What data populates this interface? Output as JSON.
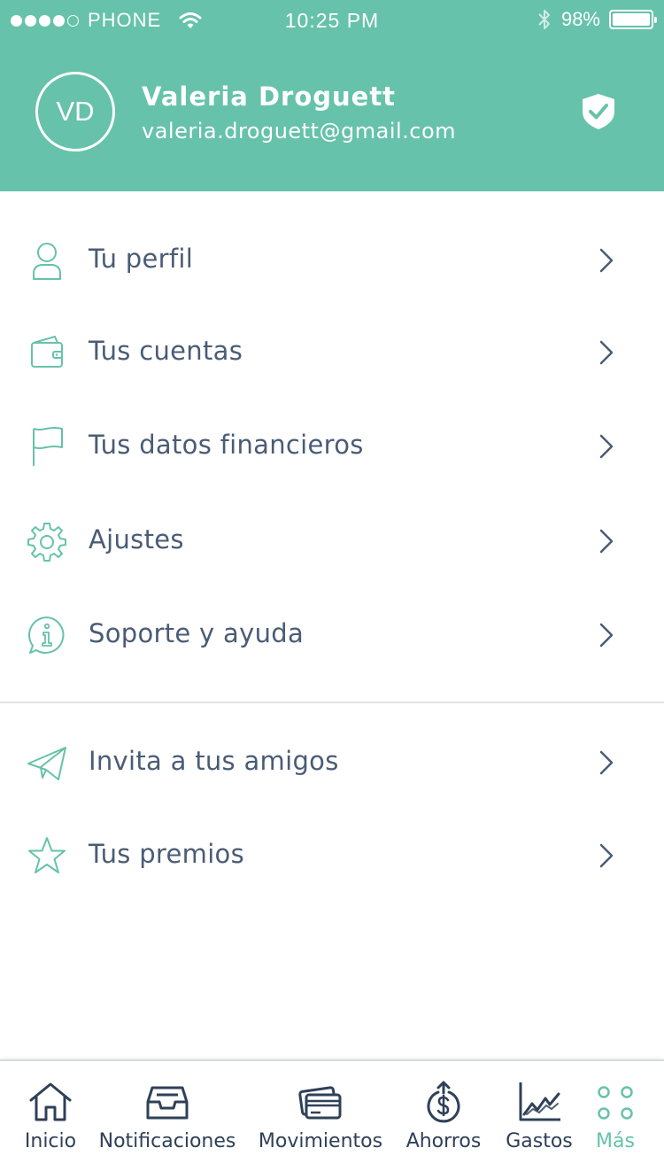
{
  "status_bar": {
    "carrier": "PHONE",
    "time": "10:25 PM",
    "battery": "98%"
  },
  "profile": {
    "initials": "VD",
    "name": "Valeria Droguett",
    "email": "valeria.droguett@gmail.com"
  },
  "menu": {
    "primary": [
      {
        "label": "Tu perfil",
        "icon": "user-icon"
      },
      {
        "label": "Tus cuentas",
        "icon": "wallet-icon"
      },
      {
        "label": "Tus datos financieros",
        "icon": "flag-icon"
      },
      {
        "label": "Ajustes",
        "icon": "gear-icon"
      },
      {
        "label": "Soporte y ayuda",
        "icon": "info-icon"
      }
    ],
    "secondary": [
      {
        "label": "Invita a tus amigos",
        "icon": "paper-plane-icon"
      },
      {
        "label": "Tus premios",
        "icon": "star-icon"
      }
    ]
  },
  "tabbar": {
    "items": [
      {
        "label": "Inicio",
        "icon": "home-icon",
        "active": false
      },
      {
        "label": "Notificaciones",
        "icon": "inbox-icon",
        "active": false
      },
      {
        "label": "Movimientos",
        "icon": "cards-icon",
        "active": false
      },
      {
        "label": "Ahorros",
        "icon": "savings-icon",
        "active": false
      },
      {
        "label": "Gastos",
        "icon": "chart-icon",
        "active": false
      },
      {
        "label": "Más",
        "icon": "more-icon",
        "active": true
      }
    ]
  },
  "colors": {
    "brand": "#66c2aa",
    "text": "#4a5c75",
    "tab_text": "#2f4058"
  }
}
